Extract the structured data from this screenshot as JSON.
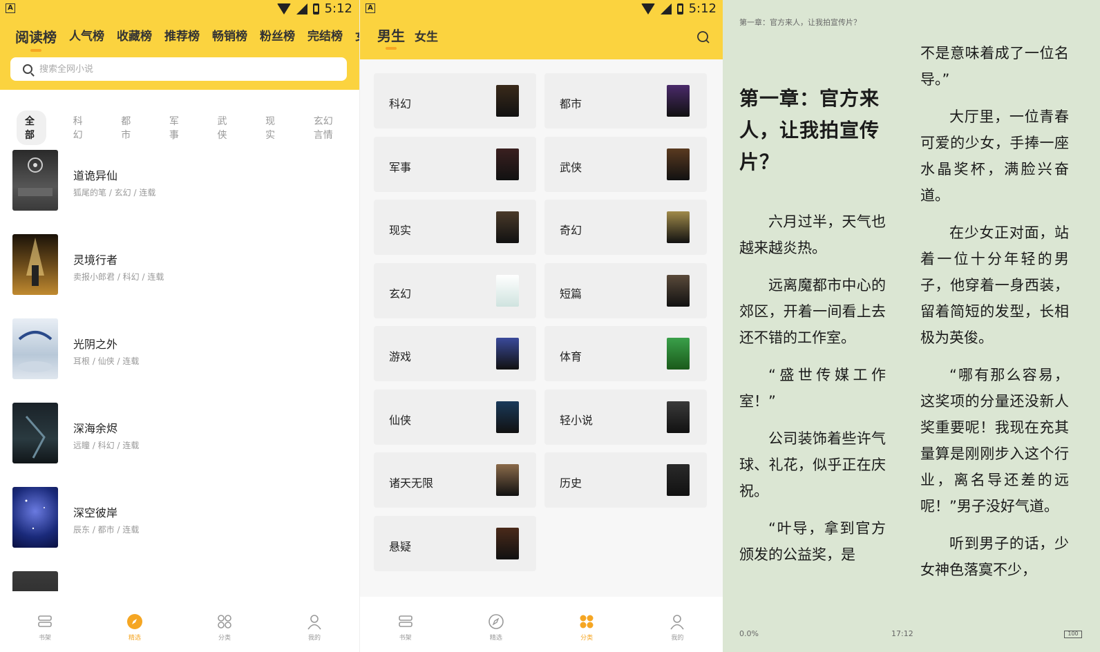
{
  "status": {
    "time": "5:12"
  },
  "ranking": {
    "tabs": [
      "阅读榜",
      "人气榜",
      "收藏榜",
      "推荐榜",
      "畅销榜",
      "粉丝榜",
      "完结榜",
      "女"
    ],
    "search_placeholder": "搜索全网小说",
    "categories": [
      "全部",
      "科幻",
      "都市",
      "军事",
      "武侠",
      "现实",
      "玄幻言情"
    ],
    "books": [
      {
        "title": "道诡异仙",
        "meta": "狐尾的笔 / 玄幻 / 连载"
      },
      {
        "title": "灵境行者",
        "meta": "卖报小郎君 / 科幻 / 连载"
      },
      {
        "title": "光阴之外",
        "meta": "耳根 / 仙侠 / 连载"
      },
      {
        "title": "深海余烬",
        "meta": "远瞳 / 科幻 / 连载"
      },
      {
        "title": "深空彼岸",
        "meta": "辰东 / 都市 / 连载"
      },
      {
        "title": "",
        "meta": ""
      }
    ]
  },
  "nav1": [
    "书架",
    "精选",
    "分类",
    "我的"
  ],
  "classify": {
    "tabs": [
      "男生",
      "女生"
    ],
    "items": [
      "科幻",
      "都市",
      "军事",
      "武侠",
      "现实",
      "奇幻",
      "玄幻",
      "短篇",
      "游戏",
      "体育",
      "仙侠",
      "轻小说",
      "诸天无限",
      "历史",
      "悬疑"
    ],
    "colors": [
      "#3a2a1a",
      "#4a2a6a",
      "#3a2020",
      "#5a3a20",
      "#4a3a2a",
      "#a08a4a",
      "#cfe3df",
      "#5a4a3a",
      "#3a4a9a",
      "#2a8a3a",
      "#1a3a5a",
      "#3a3a3a",
      "#8a6a4a",
      "#2a2a2a",
      "#4a2a1a"
    ]
  },
  "nav2": [
    "书架",
    "精选",
    "分类",
    "我的"
  ],
  "reader": {
    "header": "第一章：官方来人，让我拍宣传片？",
    "chapter_title": "第一章：官方来人，让我拍宣传片？",
    "left_paras": [
      "六月过半，天气也越来越炎热。",
      "远离魔都市中心的郊区，开着一间看上去还不错的工作室。",
      "“盛世传媒工作室！”",
      "公司装饰着些许气球、礼花，似乎正在庆祝。",
      "“叶导，拿到官方颁发的公益奖，是"
    ],
    "right_paras": [
      "不是意味着成了一位名导。”",
      "大厅里，一位青春可爱的少女，手捧一座水晶奖杯，满脸兴奋道。",
      "在少女正对面，站着一位十分年轻的男子，他穿着一身西装，留着简短的发型，长相极为英俊。",
      "“哪有那么容易，这奖项的分量还没新人奖重要呢！我现在充其量算是刚刚步入这个行业，离名导还差的远呢！”男子没好气道。",
      "听到男子的话，少女神色落寞不少，"
    ],
    "progress": "0.0%",
    "clock": "17:12",
    "battery": "100"
  },
  "colors": {
    "accent": "#fbd33f",
    "active": "#f5a623",
    "reader_bg": "#dbe6d3"
  }
}
